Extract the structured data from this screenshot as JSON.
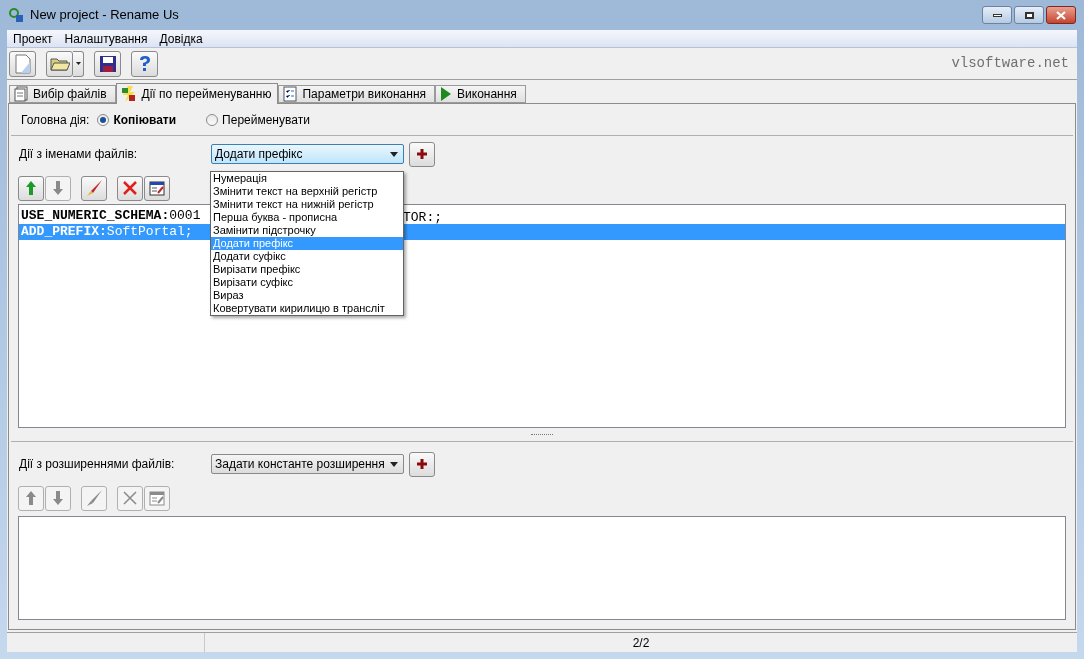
{
  "window": {
    "title": "New project - Rename Us"
  },
  "menu": [
    "Проект",
    "Налаштування",
    "Довідка"
  ],
  "toolbar": {
    "buttons": [
      {
        "kind": "new"
      },
      {
        "kind": "open"
      },
      {
        "kind": "save"
      },
      {
        "kind": "help"
      }
    ],
    "site": "vlsoftware.net"
  },
  "tabs": [
    {
      "label": "Вибір файлів",
      "kind": "files",
      "selected": false
    },
    {
      "label": "Дії по перейменуванню",
      "kind": "rename",
      "selected": true
    },
    {
      "label": "Параметри виконання",
      "kind": "params",
      "selected": false
    },
    {
      "label": "Виконання",
      "kind": "run",
      "selected": false
    }
  ],
  "main_action": {
    "label": "Головна дія:",
    "options": [
      {
        "label": "Копіювати",
        "selected": true
      },
      {
        "label": "Перейменувати",
        "selected": false
      }
    ]
  },
  "name_actions": {
    "label": "Дії з іменами файлів:",
    "combo": "Додати префікс",
    "actions": [
      {
        "kind": "up",
        "disabled": false
      },
      {
        "kind": "down",
        "disabled": true
      },
      {
        "kind": "edit",
        "disabled": false
      },
      {
        "kind": "delete",
        "disabled": false
      },
      {
        "kind": "properties",
        "disabled": false
      }
    ],
    "rules": [
      {
        "key": "USE_NUMERIC_SCHEMA:",
        "value": "0001",
        "tail": "TOR:;",
        "selected": false
      },
      {
        "key": "ADD_PREFIX:",
        "value": "SoftPortal;",
        "selected": true
      }
    ],
    "dropdown": [
      {
        "label": "Нумерація",
        "selected": false
      },
      {
        "label": "Змінити текст на верхній регістр",
        "selected": false
      },
      {
        "label": "Змінити текст на нижній регістр",
        "selected": false
      },
      {
        "label": "Перша буква - прописна",
        "selected": false
      },
      {
        "label": "Замінити підстрочку",
        "selected": false
      },
      {
        "label": "Додати префікс",
        "selected": true
      },
      {
        "label": "Додати суфікс",
        "selected": false
      },
      {
        "label": "Вирізати префікс",
        "selected": false
      },
      {
        "label": "Вирізати суфікс",
        "selected": false
      },
      {
        "label": "Вираз",
        "selected": false
      },
      {
        "label": "Ковертувати кирилицю в трансліт",
        "selected": false
      }
    ]
  },
  "ext_actions": {
    "label": "Дії з розширеннями файлів:",
    "combo": "Задати константе розширення",
    "actions": [
      {
        "kind": "up",
        "disabled": true
      },
      {
        "kind": "down",
        "disabled": true
      },
      {
        "kind": "edit",
        "disabled": true
      },
      {
        "kind": "delete",
        "disabled": true
      },
      {
        "kind": "properties",
        "disabled": true
      }
    ]
  },
  "status_bar": {
    "position": "2/2"
  }
}
